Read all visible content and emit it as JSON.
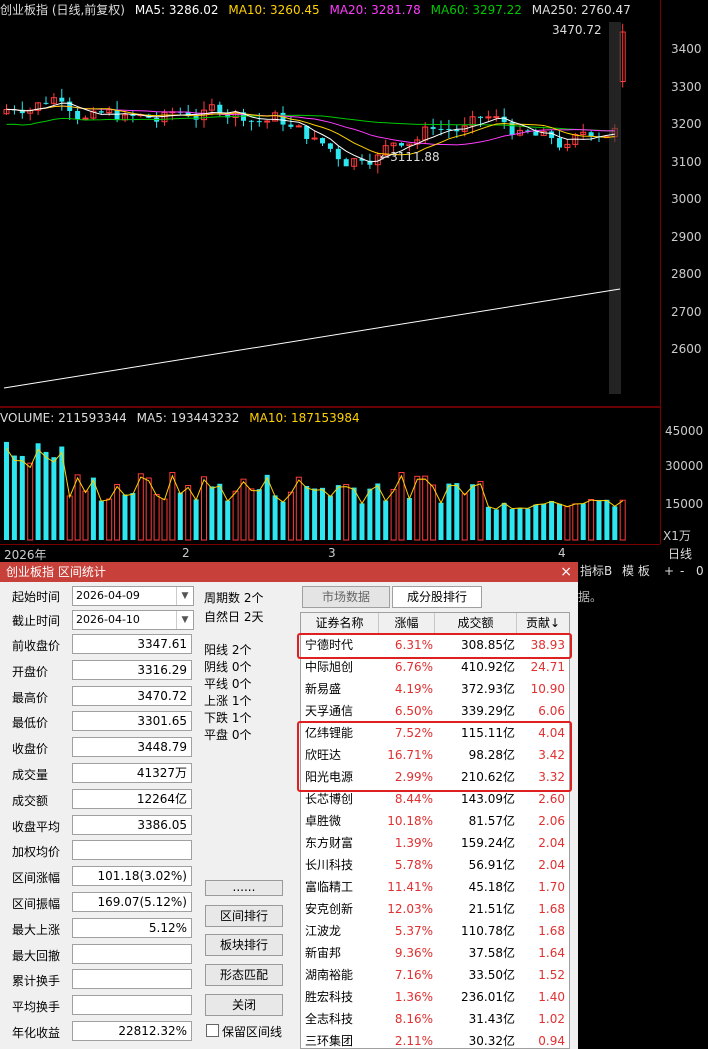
{
  "price_pane": {
    "header": {
      "index_name": "创业板指 (日线,前复权)",
      "ma5": "MA5: 3286.02",
      "ma10": "MA10: 3260.45",
      "ma20": "MA20: 3281.78",
      "ma60": "MA60: 3297.22",
      "ma250": "MA250: 2760.47"
    },
    "high_label": "3470.72",
    "low_label": "3111.88",
    "y_ticks": [
      "3400",
      "3300",
      "3200",
      "3100",
      "3000",
      "2900",
      "2800",
      "2700",
      "2600"
    ],
    "colors": {
      "up": "#ff3b3b",
      "down": "#2ee6f0",
      "ma5": "#ffffff",
      "ma10": "#ffd200",
      "ma20": "#ff3cff",
      "ma60": "#00c800",
      "ma250": "#ffffff"
    }
  },
  "volume_pane": {
    "header": {
      "volume": "VOLUME: 211593344",
      "ma5": "MA5: 193443232",
      "ma10": "MA10: 187153984"
    },
    "y_ticks": [
      "45000",
      "30000",
      "15000"
    ],
    "unit": "X1万"
  },
  "x_axis": {
    "labels": [
      "2026年",
      "2",
      "3",
      "4"
    ]
  },
  "right_toolbar": {
    "items": [
      "日线",
      "指标B",
      "模 板",
      "+",
      "-",
      "0"
    ],
    "partial_text": "据。"
  },
  "dialog": {
    "title": "创业板指 区间统计",
    "close": "×",
    "start_label": "起始时间",
    "start_value": "2026-04-09",
    "end_label": "截止时间",
    "end_value": "2026-04-10",
    "period_count": "周期数 2个",
    "natural_days": "自然日 2天",
    "fields": [
      {
        "label": "前收盘价",
        "value": "3347.61"
      },
      {
        "label": "开盘价",
        "value": "3316.29"
      },
      {
        "label": "最高价",
        "value": "3470.72"
      },
      {
        "label": "最低价",
        "value": "3301.65"
      },
      {
        "label": "收盘价",
        "value": "3448.79"
      },
      {
        "label": "成交量",
        "value": "41327万"
      },
      {
        "label": "成交额",
        "value": "12264亿"
      },
      {
        "label": "收盘平均",
        "value": "3386.05"
      },
      {
        "label": "加权均价",
        "value": ""
      },
      {
        "label": "区间涨幅",
        "value": "101.18(3.02%)"
      },
      {
        "label": "区间振幅",
        "value": "169.07(5.12%)"
      },
      {
        "label": "最大上涨",
        "value": "5.12%"
      },
      {
        "label": "最大回撤",
        "value": ""
      },
      {
        "label": "累计换手",
        "value": ""
      },
      {
        "label": "平均换手",
        "value": ""
      },
      {
        "label": "年化收益",
        "value": "22812.32%"
      }
    ],
    "stats": [
      "阳线 2个",
      "阴线 0个",
      "平线 0个",
      "上涨 1个",
      "下跌 1个",
      "平盘 0个"
    ],
    "buttons": [
      "......",
      "区间排行",
      "板块排行",
      "形态匹配",
      "关闭"
    ],
    "keep_line": "保留区间线",
    "tabs": [
      "市场数据",
      "成分股排行"
    ],
    "table": {
      "headers": [
        "证券名称",
        "涨幅",
        "成交额",
        "贡献↓"
      ],
      "rows": [
        [
          "宁德时代",
          "6.31%",
          "308.85亿",
          "38.93"
        ],
        [
          "中际旭创",
          "6.76%",
          "410.92亿",
          "24.71"
        ],
        [
          "新易盛",
          "4.19%",
          "372.93亿",
          "10.90"
        ],
        [
          "天孚通信",
          "6.50%",
          "339.29亿",
          "6.06"
        ],
        [
          "亿纬锂能",
          "7.52%",
          "115.11亿",
          "4.04"
        ],
        [
          "欣旺达",
          "16.71%",
          "98.28亿",
          "3.42"
        ],
        [
          "阳光电源",
          "2.99%",
          "210.62亿",
          "3.32"
        ],
        [
          "长芯博创",
          "8.44%",
          "143.09亿",
          "2.60"
        ],
        [
          "卓胜微",
          "10.18%",
          "81.57亿",
          "2.06"
        ],
        [
          "东方财富",
          "1.39%",
          "159.24亿",
          "2.04"
        ],
        [
          "长川科技",
          "5.78%",
          "56.91亿",
          "2.04"
        ],
        [
          "富临精工",
          "11.41%",
          "45.18亿",
          "1.70"
        ],
        [
          "安克创新",
          "12.03%",
          "21.51亿",
          "1.68"
        ],
        [
          "江波龙",
          "5.37%",
          "110.78亿",
          "1.68"
        ],
        [
          "新宙邦",
          "9.36%",
          "37.58亿",
          "1.64"
        ],
        [
          "湖南裕能",
          "7.16%",
          "33.50亿",
          "1.52"
        ],
        [
          "胜宏科技",
          "1.36%",
          "236.01亿",
          "1.40"
        ],
        [
          "全志科技",
          "8.16%",
          "31.43亿",
          "1.02"
        ],
        [
          "三环集团",
          "2.11%",
          "30.32亿",
          "0.94"
        ]
      ]
    }
  }
}
